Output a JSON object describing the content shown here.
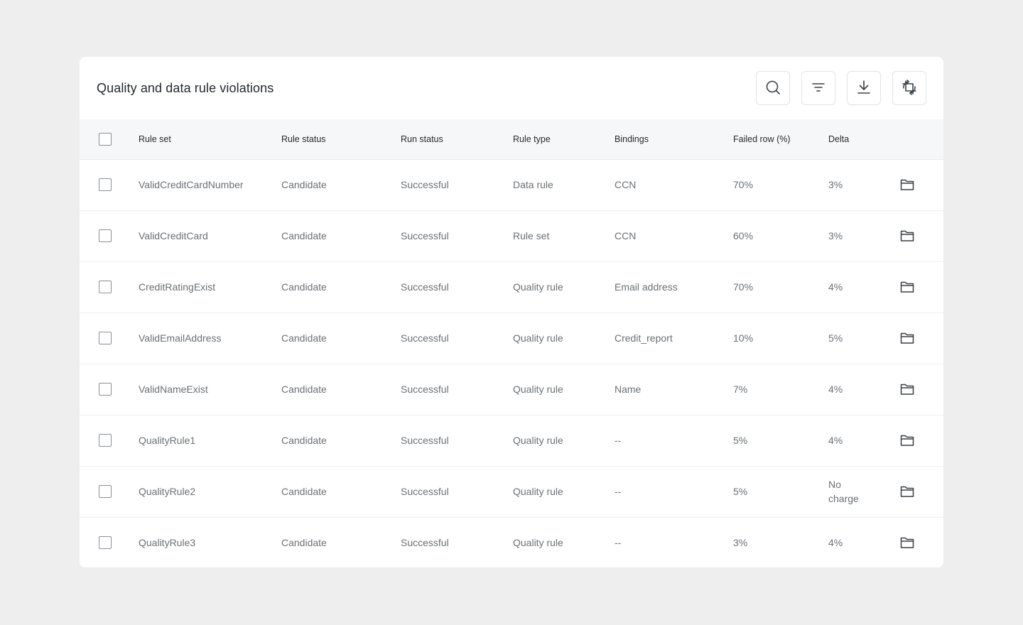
{
  "header": {
    "title": "Quality and data rule violations",
    "tools": [
      {
        "name": "search-button",
        "icon": "search-icon"
      },
      {
        "name": "filter-button",
        "icon": "filter-icon"
      },
      {
        "name": "download-button",
        "icon": "download-icon"
      },
      {
        "name": "refresh-button",
        "icon": "crop-rotate-icon"
      }
    ]
  },
  "table": {
    "columns": {
      "rule_set": "Rule set",
      "rule_status": "Rule status",
      "run_status": "Run status",
      "rule_type": "Rule type",
      "bindings": "Bindings",
      "failed_row": "Failed row (%)",
      "delta": "Delta"
    },
    "rows": [
      {
        "rule_set": "ValidCreditCardNumber",
        "rule_status": "Candidate",
        "run_status": "Successful",
        "rule_type": "Data rule",
        "bindings": "CCN",
        "failed_row": "70%",
        "delta": "3%"
      },
      {
        "rule_set": "ValidCreditCard",
        "rule_status": "Candidate",
        "run_status": "Successful",
        "rule_type": "Rule set",
        "bindings": "CCN",
        "failed_row": "60%",
        "delta": "3%"
      },
      {
        "rule_set": "CreditRatingExist",
        "rule_status": "Candidate",
        "run_status": "Successful",
        "rule_type": "Quality rule",
        "bindings": "Email address",
        "failed_row": "70%",
        "delta": "4%"
      },
      {
        "rule_set": "ValidEmailAddress",
        "rule_status": "Candidate",
        "run_status": "Successful",
        "rule_type": "Quality rule",
        "bindings": "Credit_report",
        "failed_row": "10%",
        "delta": "5%"
      },
      {
        "rule_set": "ValidNameExist",
        "rule_status": "Candidate",
        "run_status": "Successful",
        "rule_type": "Quality rule",
        "bindings": "Name",
        "failed_row": "7%",
        "delta": "4%"
      },
      {
        "rule_set": "QualityRule1",
        "rule_status": "Candidate",
        "run_status": "Successful",
        "rule_type": "Quality rule",
        "bindings": "--",
        "failed_row": "5%",
        "delta": "4%"
      },
      {
        "rule_set": "QualityRule2",
        "rule_status": "Candidate",
        "run_status": "Successful",
        "rule_type": "Quality rule",
        "bindings": "--",
        "failed_row": "5%",
        "delta": "No charge"
      },
      {
        "rule_set": "QualityRule3",
        "rule_status": "Candidate",
        "run_status": "Successful",
        "rule_type": "Quality rule",
        "bindings": "--",
        "failed_row": "3%",
        "delta": "4%"
      }
    ]
  }
}
